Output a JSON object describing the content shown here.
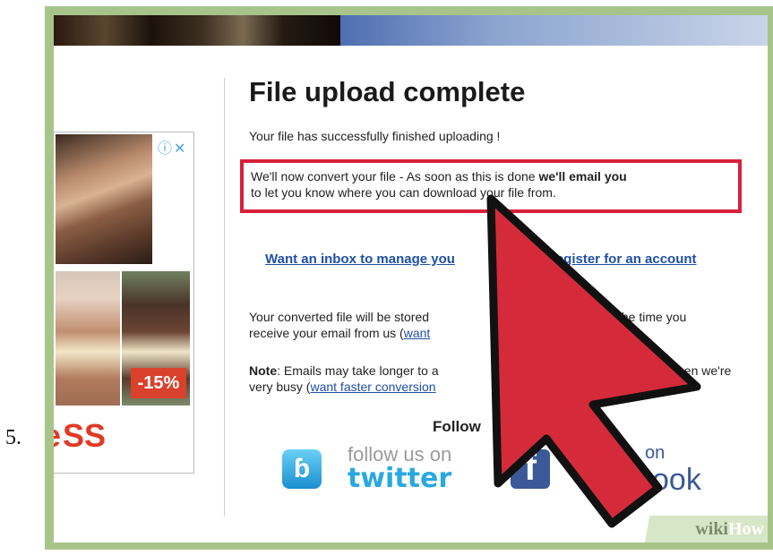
{
  "step_number": "5.",
  "ad": {
    "discount": "-15%",
    "brand_fragment": "SS",
    "brand_c": "e",
    "controls": "ⓘ✕"
  },
  "content": {
    "title": "File upload complete",
    "success_text": "Your file has successfully finished uploading !",
    "convert_text_1": "We'll now convert your file - As soon as this is done ",
    "convert_text_bold": "we'll email you",
    "convert_text_2": "to let you know where you can download your file from.",
    "inbox_link_visible": "Want an inbox to manage you",
    "register_link_visible": "Register for an account",
    "stored_text_line1": "Your converted file will be stored",
    "stored_text_line1_end": "the time you",
    "stored_text_line2": "receive your email from us (",
    "stored_link_partial": "want",
    "note_label": "Note",
    "note_text": ": Emails may take longer to a",
    "note_text_end": "hen we're",
    "note_line2": "very busy (",
    "note_link_partial": "want faster conversion",
    "follow_heading_partial": "Follow",
    "twitter_top": "follow us on",
    "twitter_brand": "twitter",
    "facebook_top": "on",
    "facebook_brand": "ook"
  },
  "watermark": {
    "wiki": "wiki",
    "how": "How"
  },
  "colors": {
    "frame": "#a7c58a",
    "highlight_border": "#d9203a",
    "cursor": "#d42a3a",
    "link": "#1f4fa8"
  }
}
